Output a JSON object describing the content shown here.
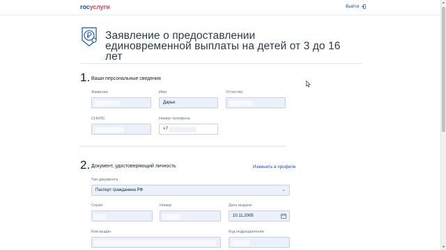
{
  "header": {
    "logo_gos": "гос",
    "logo_uslugi": "услуги",
    "logout_label": "Выйти",
    "logout_icon": "logout-icon"
  },
  "page": {
    "title": "Заявление о предоставлении единовременной выплаты на детей от 3 до 16 лет",
    "hero_icon": "ruble-coins-icon"
  },
  "section1": {
    "number": "1.",
    "title": "Ваши персональные сведения",
    "fields": {
      "surname_label": "Фамилия",
      "name_label": "Имя",
      "name_value": "Дарья",
      "patronymic_label": "Отчество",
      "snils_label": "СНИЛС",
      "phone_label": "Номер телефона",
      "phone_prefix": "+7"
    }
  },
  "section2": {
    "number": "2.",
    "title": "Документ, удостоверяющий личность",
    "edit_link": "Изменить в профиле",
    "fields": {
      "doc_type_label": "Тип документа",
      "doc_type_value": "Паспорт гражданина РФ",
      "series_label": "Серия",
      "number_label": "Номер",
      "issue_date_label": "Дата выдачи",
      "issue_date_value": "10.11.2005",
      "issued_by_label": "Кем выдан",
      "division_code_label": "Код подразделения"
    }
  },
  "colors": {
    "brand_blue": "#0d4cd3",
    "brand_red": "#ee3f58",
    "field_bg": "#eaf1fa",
    "field_border": "#c8d1dc"
  }
}
